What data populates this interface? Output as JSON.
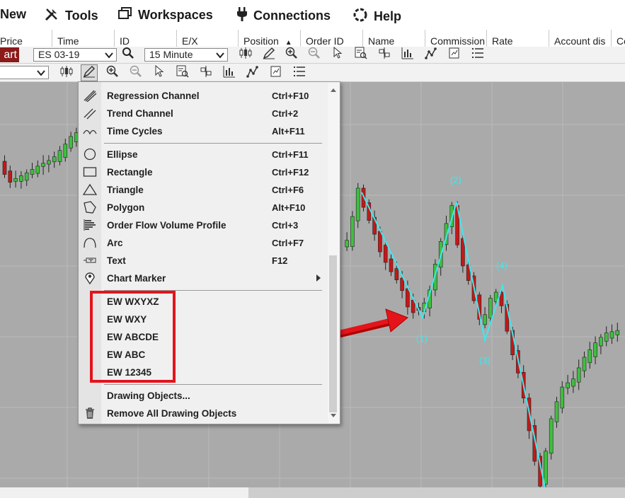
{
  "menubar": {
    "items": [
      {
        "label": "New",
        "icon": "new-icon"
      },
      {
        "label": "Tools",
        "icon": "tools-icon"
      },
      {
        "label": "Workspaces",
        "icon": "workspaces-icon"
      },
      {
        "label": "Connections",
        "icon": "plug-icon"
      },
      {
        "label": "Help",
        "icon": "help-icon"
      }
    ]
  },
  "columns": [
    "Price",
    "Time",
    "ID",
    "E/X",
    "Position",
    "Order ID",
    "Name",
    "Commission",
    "Rate",
    "Account dis",
    "Co"
  ],
  "chart_toolbar": {
    "chart_button": "art",
    "instrument": "ES 03-19",
    "interval": "15 Minute"
  },
  "menu": {
    "items": [
      {
        "label": "Regression Channel",
        "shortcut": "Ctrl+F10",
        "icon": "regression-channel-icon"
      },
      {
        "label": "Trend Channel",
        "shortcut": "Ctrl+2",
        "icon": "trend-channel-icon"
      },
      {
        "label": "Time Cycles",
        "shortcut": "Alt+F11",
        "icon": "time-cycles-icon"
      },
      {
        "label": "Ellipse",
        "shortcut": "Ctrl+F11",
        "icon": "ellipse-icon"
      },
      {
        "label": "Rectangle",
        "shortcut": "Ctrl+F12",
        "icon": "rectangle-icon"
      },
      {
        "label": "Triangle",
        "shortcut": "Ctrl+F6",
        "icon": "triangle-icon"
      },
      {
        "label": "Polygon",
        "shortcut": "Alt+F10",
        "icon": "polygon-icon"
      },
      {
        "label": "Order Flow Volume Profile",
        "shortcut": "Ctrl+3",
        "icon": "volume-profile-icon"
      },
      {
        "label": "Arc",
        "shortcut": "Ctrl+F7",
        "icon": "arc-icon"
      },
      {
        "label": "Text",
        "shortcut": "F12",
        "icon": "text-icon"
      },
      {
        "label": "Chart Marker",
        "shortcut": "",
        "icon": "chart-marker-icon"
      },
      {
        "label": "EW WXYXZ",
        "shortcut": ""
      },
      {
        "label": "EW WXY",
        "shortcut": ""
      },
      {
        "label": "EW ABCDE",
        "shortcut": ""
      },
      {
        "label": "EW ABC",
        "shortcut": ""
      },
      {
        "label": "EW 12345",
        "shortcut": ""
      },
      {
        "label": "Drawing Objects...",
        "shortcut": ""
      },
      {
        "label": "Remove All Drawing Objects",
        "shortcut": "",
        "icon": "trash-icon"
      }
    ]
  },
  "wave_labels": [
    "(1)",
    "(2)",
    "(3)",
    "(4)"
  ],
  "colors": {
    "chart_bg": "#aaaaaa",
    "up_candle": "#3fbf3f",
    "down_candle": "#c41818",
    "wave_line": "#3fe8ee",
    "annotation": "#e4141b",
    "chart_button": "#8b1a1a"
  }
}
